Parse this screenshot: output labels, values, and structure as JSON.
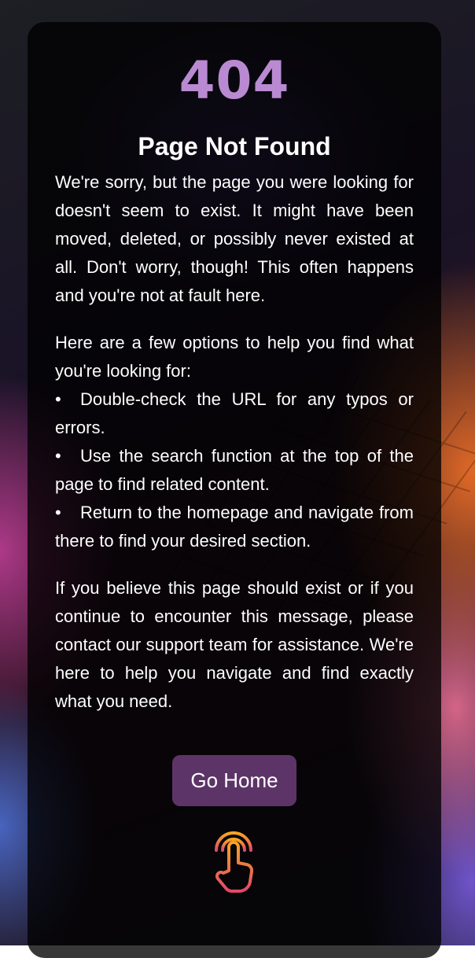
{
  "error": {
    "code": "404",
    "title": "Page Not Found"
  },
  "content": {
    "intro": "We're sorry, but the page you were looking for doesn't seem to exist. It might have been moved, deleted, or possibly never existed at all. Don't worry, though! This often happens and you're not at fault here.",
    "options_intro": "Here are a few options to help you find what you're looking for:",
    "options": [
      "Double-check the URL for any typos or errors.",
      "Use the search function at the top of the page to find related content.",
      "Return to the homepage and navigate from there to find your desired section."
    ],
    "support": "If you believe this page should exist or if you continue to encounter this message, please contact our support team for assistance. We're here to help you navigate and find exactly what you need."
  },
  "actions": {
    "home_label": "Go Home"
  },
  "icons": {
    "tap": "tap-hand-icon"
  },
  "colors": {
    "code": "#b98ad1",
    "button": "#5d3467",
    "card": "rgba(0,0,0,0.78)"
  }
}
